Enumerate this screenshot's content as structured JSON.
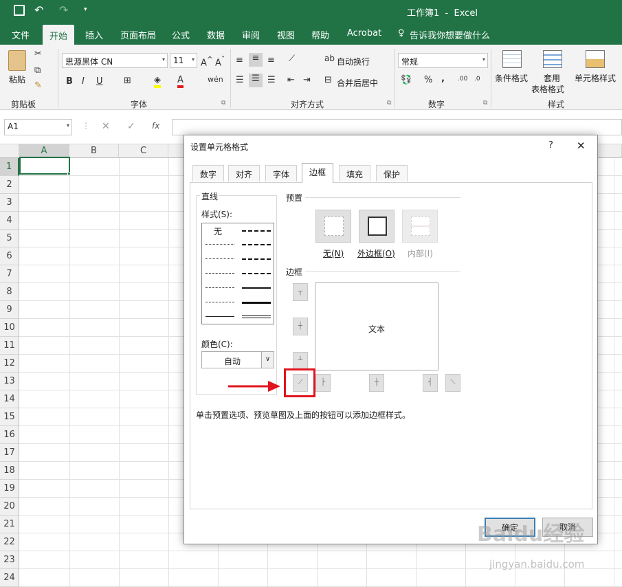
{
  "titlebar": {
    "title": "工作簿1  -  Excel"
  },
  "tabs": [
    {
      "label": "文件"
    },
    {
      "label": "开始"
    },
    {
      "label": "插入"
    },
    {
      "label": "页面布局"
    },
    {
      "label": "公式"
    },
    {
      "label": "数据"
    },
    {
      "label": "审阅"
    },
    {
      "label": "视图"
    },
    {
      "label": "帮助"
    },
    {
      "label": "Acrobat"
    },
    {
      "label": "告诉我你想要做什么"
    }
  ],
  "ribbon": {
    "paste_label": "粘贴",
    "clipboard_label": "剪贴板",
    "font_name": "思源黑体 CN",
    "font_size": "11",
    "font_label": "字体",
    "bold": "B",
    "italic": "I",
    "underline": "U",
    "wrap_text": "自动换行",
    "merge_center": "合并后居中",
    "align_label": "对齐方式",
    "number_format": "常规",
    "number_label": "数字",
    "cond_format": "条件格式",
    "table_format_1": "套用",
    "table_format_2": "表格格式",
    "cell_style": "单元格样式",
    "style_label": "样式"
  },
  "formula": {
    "name_box": "A1",
    "fx": "fx"
  },
  "columns": [
    "A",
    "B",
    "C"
  ],
  "rows": [
    "1",
    "2",
    "3",
    "4",
    "5",
    "6",
    "7",
    "8",
    "9",
    "10",
    "11",
    "12",
    "13",
    "14",
    "15",
    "16",
    "17",
    "18",
    "19",
    "20",
    "21",
    "22",
    "23",
    "24"
  ],
  "dialog": {
    "title": "设置单元格格式",
    "help": "?",
    "close": "✕",
    "tabs": [
      {
        "label": "数字"
      },
      {
        "label": "对齐"
      },
      {
        "label": "字体"
      },
      {
        "label": "边框"
      },
      {
        "label": "填充"
      },
      {
        "label": "保护"
      }
    ],
    "line_group": "直线",
    "style_label": "样式(S):",
    "style_none": "无",
    "color_label": "颜色(C):",
    "color_value": "自动",
    "preset_group": "预置",
    "presets": [
      {
        "label": "无(N)"
      },
      {
        "label": "外边框(O)"
      },
      {
        "label": "内部(I)"
      }
    ],
    "border_group": "边框",
    "preview_text": "文本",
    "hint": "单击预置选项、预览草图及上面的按钮可以添加边框样式。",
    "ok": "确定",
    "cancel": "取消",
    "highlight_color": "#e0141e"
  },
  "watermark": {
    "text": "Baidu经验",
    "sub": "jingyan.baidu.com"
  }
}
